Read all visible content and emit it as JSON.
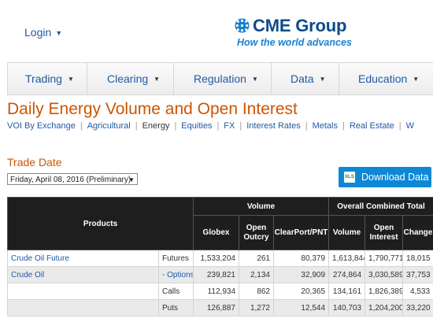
{
  "header": {
    "login_label": "Login",
    "brand_name": "CME Group",
    "brand_tagline": "How the world advances"
  },
  "nav": {
    "items": [
      {
        "label": "Trading"
      },
      {
        "label": "Clearing"
      },
      {
        "label": "Regulation"
      },
      {
        "label": "Data"
      },
      {
        "label": "Education"
      }
    ]
  },
  "page": {
    "title": "Daily Energy Volume and Open Interest",
    "subnav": [
      "VOI By Exchange",
      "Agricultural",
      "Energy",
      "Equities",
      "FX",
      "Interest Rates",
      "Metals",
      "Real Estate",
      "W"
    ],
    "subnav_current": "Energy"
  },
  "trade_date": {
    "label": "Trade Date",
    "selected": "Friday, April 08, 2016 (Preliminary)",
    "download_label": "Download Data",
    "download_icon": "XLS"
  },
  "table": {
    "products_header": "Products",
    "volume_header": "Volume",
    "oi_header": "Overall Combined Total",
    "columns": [
      "Globex",
      "Open Outcry",
      "ClearPort/PNT",
      "Volume",
      "Open Interest",
      "Change"
    ],
    "rows": [
      {
        "product": "Crude Oil Future",
        "product_link": true,
        "type": "Futures",
        "type_link": false,
        "globex": "1,533,204",
        "outcry": "261",
        "clearport": "80,379",
        "volume": "1,613,844",
        "oi": "1,790,771",
        "change": "18,015"
      },
      {
        "product": "Crude Oil",
        "product_link": true,
        "type": "- Options",
        "type_link": true,
        "globex": "239,821",
        "outcry": "2,134",
        "clearport": "32,909",
        "volume": "274,864",
        "oi": "3,030,589",
        "change": "37,753"
      },
      {
        "product": "",
        "product_link": false,
        "type": "Calls",
        "type_link": false,
        "globex": "112,934",
        "outcry": "862",
        "clearport": "20,365",
        "volume": "134,161",
        "oi": "1,826,389",
        "change": "4,533"
      },
      {
        "product": "",
        "product_link": false,
        "type": "Puts",
        "type_link": false,
        "globex": "126,887",
        "outcry": "1,272",
        "clearport": "12,544",
        "volume": "140,703",
        "oi": "1,204,200",
        "change": "33,220"
      }
    ]
  },
  "colors": {
    "title_orange": "#cc5500",
    "link_blue": "#1f5aa5",
    "brand_navy": "#0f4b8a",
    "button_blue": "#0e88d4",
    "table_header": "#1e1e1e"
  }
}
